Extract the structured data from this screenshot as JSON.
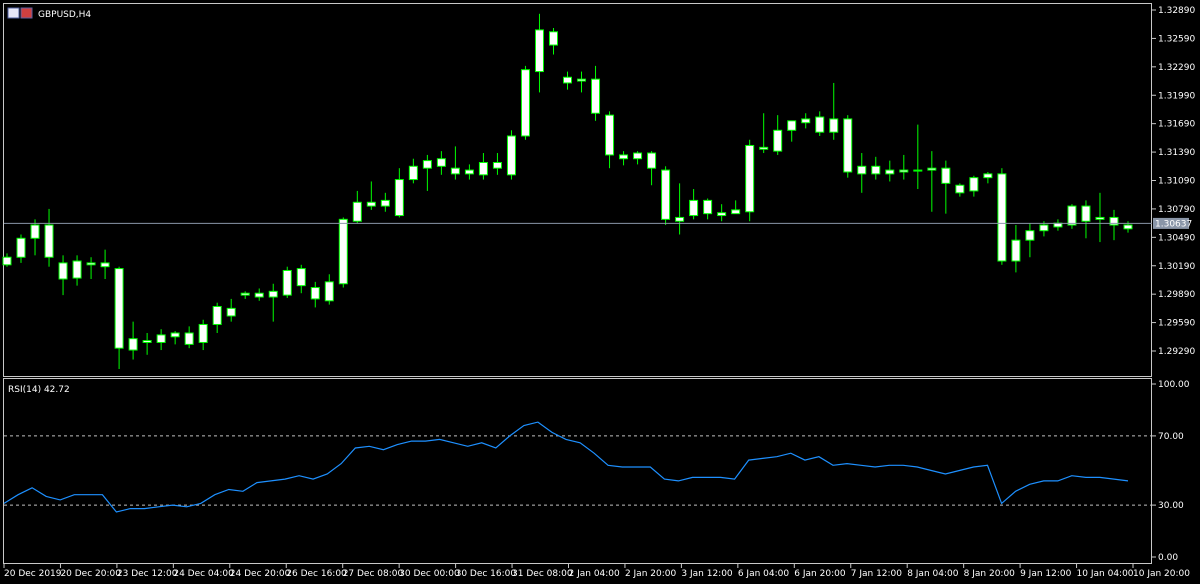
{
  "header": {
    "symbol_label": "GBPUSD,H4",
    "current_price_label": "1.30637"
  },
  "indicator": {
    "label": "RSI(14) 42.72"
  },
  "colors": {
    "background": "#000000",
    "bull_candle": "#ffffff",
    "wick": "#00ff00",
    "rsi_line": "#1e90ff",
    "price_line": "#778899",
    "level_line": "#c0c0c0"
  },
  "chart_data": [
    {
      "type": "candlestick",
      "symbol": "GBPUSD",
      "timeframe": "H4",
      "ylim": [
        1.29,
        1.33
      ],
      "y_tick_labels": [
        "1.32890",
        "1.32590",
        "1.32290",
        "1.31990",
        "1.31690",
        "1.31390",
        "1.31090",
        "1.30790",
        "1.30490",
        "1.30190",
        "1.29890",
        "1.29590",
        "1.29290"
      ],
      "current_price": 1.30637,
      "x_tick_labels": [
        "20 Dec 2019",
        "20 Dec 20:00",
        "23 Dec 12:00",
        "24 Dec 04:00",
        "24 Dec 20:00",
        "26 Dec 16:00",
        "27 Dec 08:00",
        "30 Dec 00:00",
        "30 Dec 16:00",
        "31 Dec 08:00",
        "2 Jan 04:00",
        "2 Jan 20:00",
        "3 Jan 12:00",
        "6 Jan 04:00",
        "6 Jan 20:00",
        "7 Jan 12:00",
        "8 Jan 04:00",
        "8 Jan 20:00",
        "9 Jan 12:00",
        "10 Jan 04:00",
        "10 Jan 20:00"
      ],
      "candles": [
        [
          1.302,
          1.3032,
          1.3018,
          1.3028
        ],
        [
          1.3028,
          1.3052,
          1.3022,
          1.3048
        ],
        [
          1.3048,
          1.3068,
          1.303,
          1.3062
        ],
        [
          1.3062,
          1.3079,
          1.3018,
          1.3028
        ],
        [
          1.3022,
          1.303,
          1.2988,
          1.3005
        ],
        [
          1.3006,
          1.303,
          1.2998,
          1.3024
        ],
        [
          1.302,
          1.3028,
          1.3005,
          1.3022
        ],
        [
          1.3022,
          1.3036,
          1.3005,
          1.3018
        ],
        [
          1.3016,
          1.3018,
          1.291,
          1.2932
        ],
        [
          1.293,
          1.296,
          1.292,
          1.2942
        ],
        [
          1.294,
          1.2948,
          1.2925,
          1.2938
        ],
        [
          1.2938,
          1.2952,
          1.293,
          1.2946
        ],
        [
          1.2944,
          1.295,
          1.2936,
          1.2948
        ],
        [
          1.2948,
          1.2955,
          1.2932,
          1.2936
        ],
        [
          1.2938,
          1.2962,
          1.293,
          1.2957
        ],
        [
          1.2957,
          1.298,
          1.2948,
          1.2976
        ],
        [
          1.2974,
          1.2984,
          1.296,
          1.2966
        ],
        [
          1.2988,
          1.2992,
          1.2984,
          1.299
        ],
        [
          1.299,
          1.2995,
          1.2982,
          1.2986
        ],
        [
          1.2986,
          1.3,
          1.296,
          1.2992
        ],
        [
          1.2988,
          1.3018,
          1.2985,
          1.3014
        ],
        [
          1.3016,
          1.302,
          1.299,
          1.2998
        ],
        [
          1.2996,
          1.3002,
          1.2975,
          1.2984
        ],
        [
          1.2982,
          1.301,
          1.2978,
          1.3002
        ],
        [
          1.3,
          1.307,
          1.2996,
          1.3068
        ],
        [
          1.3066,
          1.3098,
          1.3064,
          1.3086
        ],
        [
          1.3082,
          1.3108,
          1.3078,
          1.3086
        ],
        [
          1.3088,
          1.3096,
          1.3076,
          1.3082
        ],
        [
          1.3072,
          1.3122,
          1.307,
          1.311
        ],
        [
          1.311,
          1.3132,
          1.3106,
          1.3124
        ],
        [
          1.3122,
          1.3136,
          1.3098,
          1.313
        ],
        [
          1.3132,
          1.314,
          1.3115,
          1.3124
        ],
        [
          1.3122,
          1.3145,
          1.311,
          1.3116
        ],
        [
          1.3116,
          1.3126,
          1.311,
          1.312
        ],
        [
          1.3115,
          1.3138,
          1.311,
          1.3128
        ],
        [
          1.3128,
          1.3138,
          1.3115,
          1.3122
        ],
        [
          1.3115,
          1.3162,
          1.311,
          1.3156
        ],
        [
          1.3156,
          1.323,
          1.3152,
          1.3226
        ],
        [
          1.3224,
          1.3285,
          1.3202,
          1.3268
        ],
        [
          1.3266,
          1.327,
          1.3242,
          1.3252
        ],
        [
          1.3218,
          1.3224,
          1.3205,
          1.3212
        ],
        [
          1.3216,
          1.3224,
          1.3202,
          1.3214
        ],
        [
          1.3216,
          1.323,
          1.3172,
          1.318
        ],
        [
          1.3178,
          1.3182,
          1.3122,
          1.3136
        ],
        [
          1.3136,
          1.314,
          1.3125,
          1.3132
        ],
        [
          1.3132,
          1.314,
          1.3126,
          1.3138
        ],
        [
          1.3138,
          1.314,
          1.3104,
          1.3122
        ],
        [
          1.312,
          1.3124,
          1.3062,
          1.3068
        ],
        [
          1.3066,
          1.3106,
          1.3052,
          1.307
        ],
        [
          1.3072,
          1.31,
          1.3068,
          1.3088
        ],
        [
          1.3088,
          1.309,
          1.3068,
          1.3074
        ],
        [
          1.3075,
          1.3084,
          1.3066,
          1.3072
        ],
        [
          1.3074,
          1.3088,
          1.3074,
          1.3078
        ],
        [
          1.3076,
          1.3152,
          1.3066,
          1.3146
        ],
        [
          1.3142,
          1.318,
          1.3138,
          1.3144
        ],
        [
          1.314,
          1.3178,
          1.3136,
          1.3162
        ],
        [
          1.3162,
          1.317,
          1.315,
          1.3172
        ],
        [
          1.317,
          1.318,
          1.3164,
          1.3174
        ],
        [
          1.3176,
          1.3182,
          1.3156,
          1.316
        ],
        [
          1.316,
          1.3212,
          1.3152,
          1.3174
        ],
        [
          1.3174,
          1.3178,
          1.3112,
          1.3118
        ],
        [
          1.3116,
          1.3138,
          1.3096,
          1.3124
        ],
        [
          1.3124,
          1.3134,
          1.311,
          1.3116
        ],
        [
          1.3116,
          1.313,
          1.3108,
          1.312
        ],
        [
          1.312,
          1.3136,
          1.311,
          1.3118
        ],
        [
          1.312,
          1.3168,
          1.31,
          1.312
        ],
        [
          1.312,
          1.314,
          1.3076,
          1.3122
        ],
        [
          1.3122,
          1.313,
          1.3074,
          1.3106
        ],
        [
          1.3104,
          1.3106,
          1.3092,
          1.3096
        ],
        [
          1.3098,
          1.3114,
          1.3092,
          1.3112
        ],
        [
          1.3112,
          1.3118,
          1.3106,
          1.3116
        ],
        [
          1.3116,
          1.3122,
          1.302,
          1.3024
        ],
        [
          1.3024,
          1.3062,
          1.3012,
          1.3046
        ],
        [
          1.3046,
          1.3064,
          1.3028,
          1.3056
        ],
        [
          1.3056,
          1.3066,
          1.305,
          1.3062
        ],
        [
          1.306,
          1.3068,
          1.3056,
          1.3064
        ],
        [
          1.3062,
          1.3084,
          1.3058,
          1.3082
        ],
        [
          1.3082,
          1.3088,
          1.3048,
          1.3066
        ],
        [
          1.3068,
          1.3096,
          1.3044,
          1.307
        ],
        [
          1.307,
          1.3078,
          1.3046,
          1.3062
        ],
        [
          1.3062,
          1.3066,
          1.3054,
          1.3058
        ]
      ]
    },
    {
      "type": "line",
      "name": "RSI(14)",
      "ylim": [
        0,
        100
      ],
      "y_tick_labels": [
        "100.00",
        "70.00",
        "30.00",
        "0.00"
      ],
      "levels": [
        70,
        30
      ],
      "values": [
        31,
        36,
        40,
        35,
        33,
        36,
        36,
        36,
        26,
        28,
        28,
        29,
        30,
        29,
        31,
        36,
        39,
        38,
        43,
        44,
        45,
        47,
        45,
        48,
        54,
        63,
        64,
        62,
        65,
        67,
        67,
        68,
        66,
        64,
        66,
        63,
        70,
        76,
        78,
        72,
        68,
        66,
        60,
        53,
        52,
        52,
        52,
        45,
        44,
        46,
        46,
        46,
        45,
        56,
        57,
        58,
        60,
        56,
        58,
        53,
        54,
        53,
        52,
        53,
        53,
        52,
        50,
        48,
        50,
        52,
        53,
        31,
        38,
        42,
        44,
        44,
        47,
        46,
        46,
        45,
        44
      ]
    }
  ]
}
